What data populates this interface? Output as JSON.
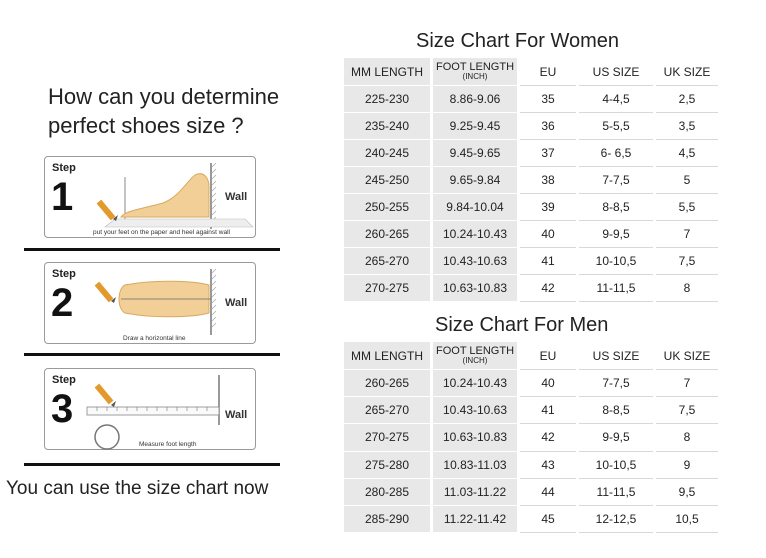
{
  "guide": {
    "question_line1": "How can you determine",
    "question_line2": "perfect shoes size ?",
    "steps": [
      {
        "step_word": "Step",
        "number": "1",
        "wall": "Wall",
        "caption": "put your feet on the paper and heel against wall"
      },
      {
        "step_word": "Step",
        "number": "2",
        "wall": "Wall",
        "caption": "Draw a horizontal line"
      },
      {
        "step_word": "Step",
        "number": "3",
        "wall": "Wall",
        "caption": "Measure foot length"
      }
    ],
    "footer": "You can use the size chart now"
  },
  "headers": {
    "mm": "MM LENGTH",
    "foot_main": "FOOT LENGTH",
    "foot_sub": "(INCH)",
    "eu": "EU",
    "us": "US SIZE",
    "uk": "UK SIZE"
  },
  "women": {
    "title": "Size Chart For Women",
    "rows": [
      {
        "mm": "225-230",
        "inch": "8.86-9.06",
        "eu": "35",
        "us": "4-4,5",
        "uk": "2,5"
      },
      {
        "mm": "235-240",
        "inch": "9.25-9.45",
        "eu": "36",
        "us": "5-5,5",
        "uk": "3,5"
      },
      {
        "mm": "240-245",
        "inch": "9.45-9.65",
        "eu": "37",
        "us": "6- 6,5",
        "uk": "4,5"
      },
      {
        "mm": "245-250",
        "inch": "9.65-9.84",
        "eu": "38",
        "us": "7-7,5",
        "uk": "5"
      },
      {
        "mm": "250-255",
        "inch": "9.84-10.04",
        "eu": "39",
        "us": "8-8,5",
        "uk": "5,5"
      },
      {
        "mm": "260-265",
        "inch": "10.24-10.43",
        "eu": "40",
        "us": "9-9,5",
        "uk": "7"
      },
      {
        "mm": "265-270",
        "inch": "10.43-10.63",
        "eu": "41",
        "us": "10-10,5",
        "uk": "7,5"
      },
      {
        "mm": "270-275",
        "inch": "10.63-10.83",
        "eu": "42",
        "us": "11-11,5",
        "uk": "8"
      }
    ]
  },
  "men": {
    "title": "Size Chart For Men",
    "rows": [
      {
        "mm": "260-265",
        "inch": "10.24-10.43",
        "eu": "40",
        "us": "7-7,5",
        "uk": "7"
      },
      {
        "mm": "265-270",
        "inch": "10.43-10.63",
        "eu": "41",
        "us": "8-8,5",
        "uk": "7,5"
      },
      {
        "mm": "270-275",
        "inch": "10.63-10.83",
        "eu": "42",
        "us": "9-9,5",
        "uk": "8"
      },
      {
        "mm": "275-280",
        "inch": "10.83-11.03",
        "eu": "43",
        "us": "10-10,5",
        "uk": "9"
      },
      {
        "mm": "280-285",
        "inch": "11.03-11.22",
        "eu": "44",
        "us": "11-11,5",
        "uk": "9,5"
      },
      {
        "mm": "285-290",
        "inch": "11.22-11.42",
        "eu": "45",
        "us": "12-12,5",
        "uk": "10,5"
      }
    ]
  },
  "colors": {
    "gray_cell": "#e8e8e8",
    "foot_fill": "#f3cf98",
    "pencil": "#e39a2d"
  }
}
